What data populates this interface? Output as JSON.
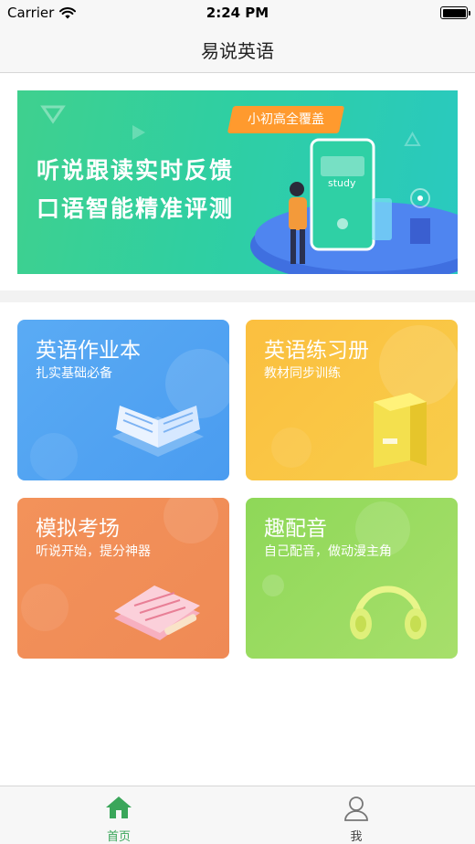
{
  "status_bar": {
    "carrier": "Carrier",
    "time": "2:24 PM"
  },
  "nav": {
    "title": "易说英语"
  },
  "banner": {
    "tag": "小初高全覆盖",
    "line1": "听说跟读实时反馈",
    "line2": "口语智能精准评测",
    "phone_text": "study"
  },
  "cards": [
    {
      "title": "英语作业本",
      "subtitle": "扎实基础必备",
      "color": "#4a9cf0",
      "icon": "open-book-icon"
    },
    {
      "title": "英语练习册",
      "subtitle": "教材同步训练",
      "color": "#f8c23e",
      "icon": "closed-book-icon"
    },
    {
      "title": "模拟考场",
      "subtitle": "听说开始，提分神器",
      "color": "#ef8a55",
      "icon": "notepad-pencil-icon"
    },
    {
      "title": "趣配音",
      "subtitle": "自己配音，做动漫主角",
      "color": "#9bdb5f",
      "icon": "headphones-icon"
    }
  ],
  "tabs": [
    {
      "label": "首页",
      "icon": "home-icon",
      "active": true
    },
    {
      "label": "我",
      "icon": "user-icon",
      "active": false
    }
  ],
  "colors": {
    "accent": "#3aa65a",
    "bar_background": "#f7f7f7"
  }
}
